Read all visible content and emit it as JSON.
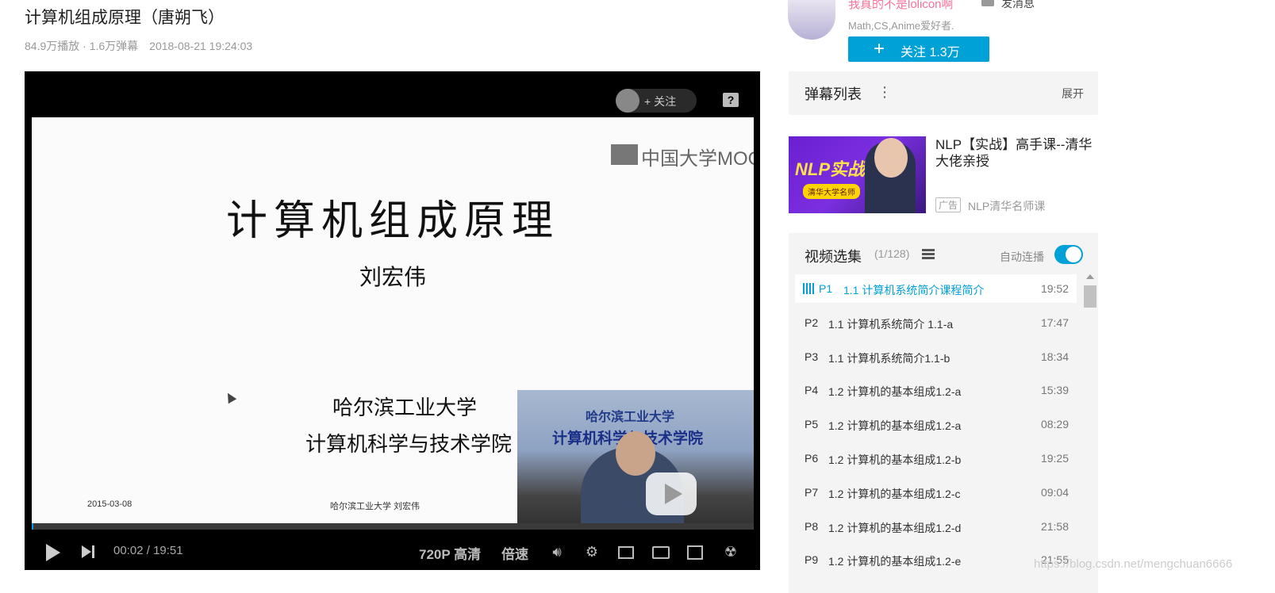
{
  "video": {
    "title": "计算机组成原理（唐朔飞）",
    "views": "84.9万播放 · 1.6万弹幕",
    "date": "2018-08-21 19:24:03"
  },
  "player": {
    "top_follow_label": "+ 关注",
    "slide": {
      "mooc_logo": "中国大学MOOC",
      "title": "计算机组成原理",
      "author": "刘宏伟",
      "org": "哈尔滨工业大学",
      "dept": "计算机科学与技术学院",
      "date": "2015-03-08",
      "footer": "哈尔滨工业大学  刘宏伟",
      "inset_line1": "哈尔滨工业大学",
      "inset_line2": "计算机科学与技术学院"
    },
    "progress": 0.002,
    "controls": {
      "time_current": "00:02",
      "time_sep": "/",
      "time_total": "19:51",
      "quality": "720P 高清",
      "speed": "倍速"
    }
  },
  "uploader": {
    "name": "我真的不是lolicon啊",
    "message_label": "发消息",
    "desc": "Math,CS,Anime爱好者.",
    "follow_label": "关注 1.3万"
  },
  "danmu": {
    "title": "弹幕列表",
    "expand_label": "展开"
  },
  "ad": {
    "image_text": "NLP实战",
    "image_tag": "清华大学名师",
    "title": "NLP【实战】高手课--清华大佬亲授",
    "badge": "广告",
    "sponsor": "NLP清华名师课"
  },
  "episodes": {
    "title": "视频选集",
    "count": "(1/128)",
    "autoplay_label": "自动连播",
    "autoplay_on": true,
    "items": [
      {
        "p": "P1",
        "name": "1.1 计算机系统简介课程简介",
        "dur": "19:52"
      },
      {
        "p": "P2",
        "name": "1.1 计算机系统简介 1.1-a",
        "dur": "17:47"
      },
      {
        "p": "P3",
        "name": "1.1 计算机系统简介1.1-b",
        "dur": "18:34"
      },
      {
        "p": "P4",
        "name": "1.2 计算机的基本组成1.2-a",
        "dur": "15:39"
      },
      {
        "p": "P5",
        "name": "1.2 计算机的基本组成1.2-a",
        "dur": "08:29"
      },
      {
        "p": "P6",
        "name": "1.2 计算机的基本组成1.2-b",
        "dur": "19:25"
      },
      {
        "p": "P7",
        "name": "1.2 计算机的基本组成1.2-c",
        "dur": "09:04"
      },
      {
        "p": "P8",
        "name": "1.2 计算机的基本组成1.2-d",
        "dur": "21:58"
      },
      {
        "p": "P9",
        "name": "1.2 计算机的基本组成1.2-e",
        "dur": "21:55"
      }
    ]
  },
  "watermark": "https://blog.csdn.net/mengchuan6666",
  "colors": {
    "accent": "#00a1d6",
    "uploader_name": "#fb7299"
  }
}
